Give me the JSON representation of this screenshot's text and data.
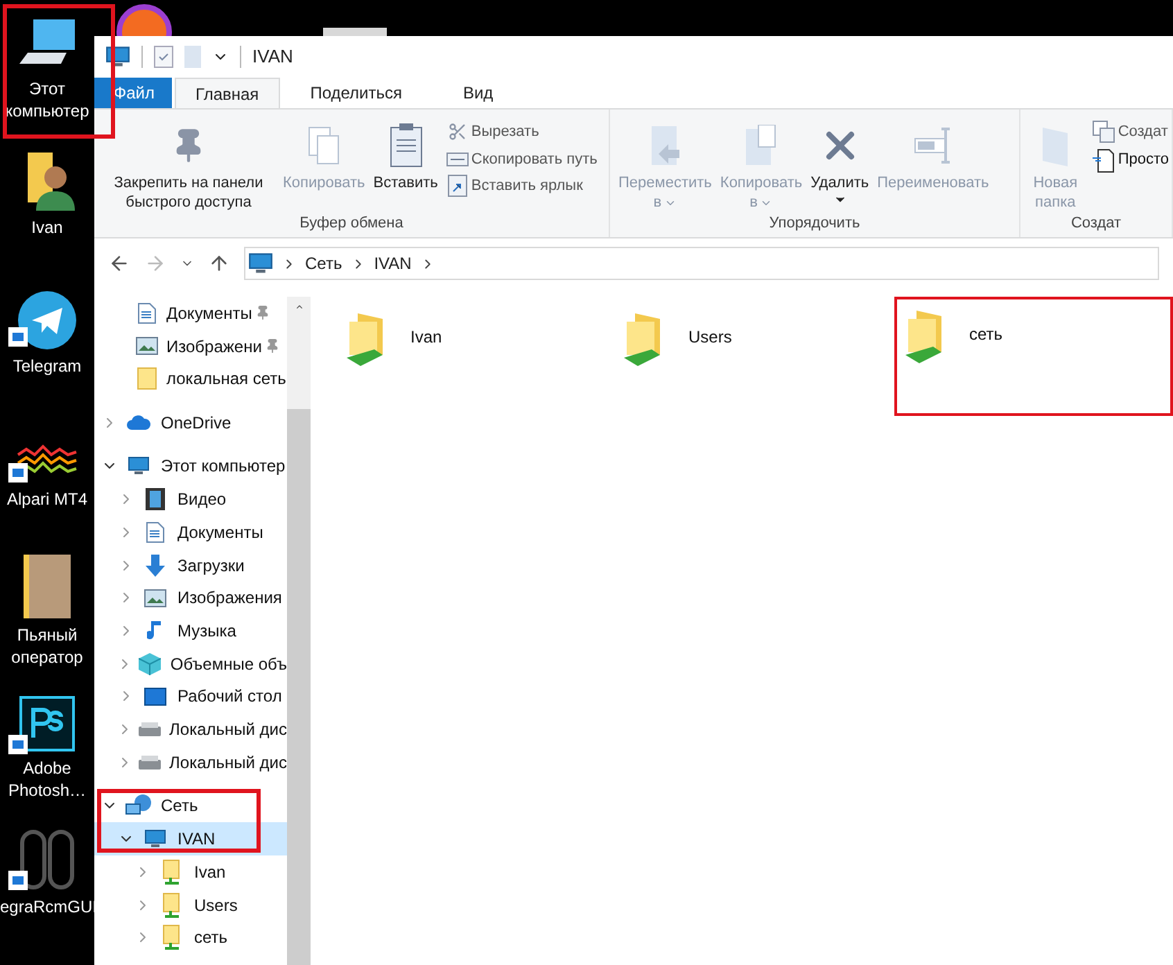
{
  "desktop": {
    "icons": [
      {
        "label": "Этот компьютер",
        "kind": "computer",
        "shortcut": false
      },
      {
        "label": "Ivan",
        "kind": "user",
        "shortcut": false
      },
      {
        "label": "Telegram",
        "kind": "telegram",
        "shortcut": true
      },
      {
        "label": "Alpari MT4",
        "kind": "waves",
        "shortcut": true
      },
      {
        "label": "Пьяный оператор",
        "kind": "photos",
        "shortcut": false
      },
      {
        "label": "Adobe Photosh…",
        "kind": "ps",
        "shortcut": true
      },
      {
        "label": "egraRcmGUI",
        "kind": "switch",
        "shortcut": true
      }
    ]
  },
  "window": {
    "title": "IVAN"
  },
  "tabs": [
    {
      "label": "Файл",
      "kind": "file",
      "selected": false
    },
    {
      "label": "Главная",
      "kind": "tab",
      "selected": true
    },
    {
      "label": "Поделиться",
      "kind": "tab",
      "selected": false
    },
    {
      "label": "Вид",
      "kind": "tab",
      "selected": false
    }
  ],
  "ribbon": {
    "groups": [
      {
        "label": "Буфер обмена",
        "large": [
          {
            "label": "Закрепить на панели быстрого доступа",
            "kind": "pin",
            "disabled": false
          },
          {
            "label": "Копировать",
            "kind": "copy",
            "disabled": true
          },
          {
            "label": "Вставить",
            "kind": "paste",
            "disabled": false
          }
        ],
        "small": [
          {
            "label": "Вырезать",
            "kind": "cut",
            "disabled": false
          },
          {
            "label": "Скопировать путь",
            "kind": "path",
            "disabled": false
          },
          {
            "label": "Вставить ярлык",
            "kind": "shortcut",
            "disabled": false
          }
        ]
      },
      {
        "label": "Упорядочить",
        "large": [
          {
            "label": "Переместить",
            "sub": "в",
            "kind": "move",
            "disabled": true
          },
          {
            "label": "Копировать",
            "sub": "в",
            "kind": "copyto",
            "disabled": true
          },
          {
            "label": "Удалить",
            "kind": "delete",
            "disabled": false
          },
          {
            "label": "Переименовать",
            "kind": "rename",
            "disabled": true
          }
        ]
      },
      {
        "label": "Создат",
        "large": [
          {
            "label": "Новая папка",
            "kind": "newfolder",
            "disabled": true
          }
        ],
        "small": [
          {
            "label": "Создат",
            "kind": "newitem",
            "disabled": false
          },
          {
            "label": "Просто",
            "kind": "easy",
            "disabled": false
          }
        ]
      }
    ]
  },
  "address_bar": {
    "path": [
      "Сеть",
      "IVAN"
    ]
  },
  "navigation_pane": {
    "quick_access": [
      {
        "label": "Документы",
        "kind": "docs",
        "pinned": true
      },
      {
        "label": "Изображени",
        "kind": "pics",
        "pinned": true
      },
      {
        "label": "локальная сеть",
        "kind": "folder",
        "pinned": false
      }
    ],
    "tree": [
      {
        "label": "OneDrive",
        "kind": "cloud",
        "expanded": false,
        "selected": false
      },
      {
        "label": "Этот компьютер",
        "kind": "computer",
        "expanded": true,
        "selected": false,
        "children": [
          {
            "label": "Видео",
            "kind": "video",
            "expanded": false,
            "selected": false
          },
          {
            "label": "Документы",
            "kind": "docs",
            "expanded": false,
            "selected": false
          },
          {
            "label": "Загрузки",
            "kind": "download",
            "expanded": false,
            "selected": false
          },
          {
            "label": "Изображения",
            "kind": "pics",
            "expanded": false,
            "selected": false
          },
          {
            "label": "Музыка",
            "kind": "music",
            "expanded": false,
            "selected": false
          },
          {
            "label": "Объемные объ",
            "kind": "cube",
            "expanded": false,
            "selected": false
          },
          {
            "label": "Рабочий стол",
            "kind": "desktop",
            "expanded": false,
            "selected": false
          },
          {
            "label": "Локальный дис",
            "kind": "drive",
            "expanded": false,
            "selected": false
          },
          {
            "label": "Локальный дис",
            "kind": "drive",
            "expanded": false,
            "selected": false
          }
        ]
      },
      {
        "label": "Сеть",
        "kind": "network",
        "expanded": true,
        "selected": false,
        "children": [
          {
            "label": "IVAN",
            "kind": "computer",
            "expanded": true,
            "selected": true,
            "children": [
              {
                "label": "Ivan",
                "kind": "share",
                "expanded": false,
                "selected": false
              },
              {
                "label": "Users",
                "kind": "share",
                "expanded": false,
                "selected": false
              },
              {
                "label": "сеть",
                "kind": "share",
                "expanded": false,
                "selected": false
              }
            ]
          }
        ]
      }
    ]
  },
  "content": {
    "items": [
      {
        "label": "Ivan",
        "highlighted": false
      },
      {
        "label": "Users",
        "highlighted": false
      },
      {
        "label": "сеть",
        "highlighted": true
      }
    ]
  },
  "annotations": {
    "desktop_computer": true,
    "network_tree": true
  }
}
